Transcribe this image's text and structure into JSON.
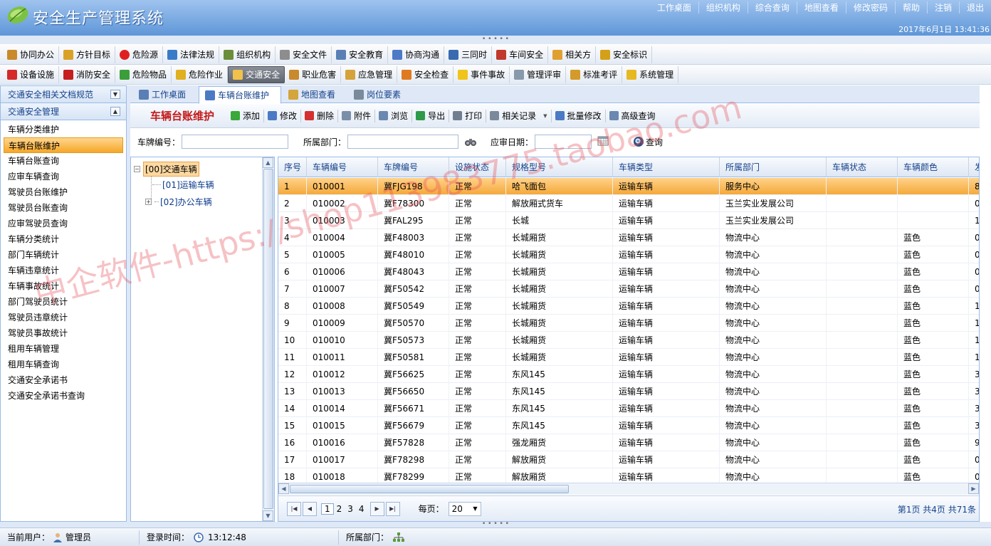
{
  "app": {
    "title": "安全生产管理系统",
    "datetime": "2017年6月1日 13:41:36"
  },
  "top_links": [
    "工作桌面",
    "组织机构",
    "综合查询",
    "地图查看",
    "修改密码",
    "帮助",
    "注销",
    "退出"
  ],
  "menu_row1": [
    {
      "label": "协同办公",
      "icon": "people-icon",
      "color": "#c98a2b"
    },
    {
      "label": "方针目标",
      "icon": "clock-icon",
      "color": "#d9a227"
    },
    {
      "label": "危险源",
      "icon": "red-dot-icon",
      "color": "#e02020"
    },
    {
      "label": "法律法规",
      "icon": "book-icon",
      "color": "#3a7bc8"
    },
    {
      "label": "组织机构",
      "icon": "org-chart-icon",
      "color": "#6b8e3a"
    },
    {
      "label": "安全文件",
      "icon": "document-icon",
      "color": "#8d8d8d"
    },
    {
      "label": "安全教育",
      "icon": "speech-icon",
      "color": "#5a7fb5"
    },
    {
      "label": "协商沟通",
      "icon": "mail-icon",
      "color": "#4c7ac6"
    },
    {
      "label": "三同时",
      "icon": "list-icon",
      "color": "#3a6ab0"
    },
    {
      "label": "车间安全",
      "icon": "worker-icon",
      "color": "#c0392b"
    },
    {
      "label": "相关方",
      "icon": "handshake-icon",
      "color": "#e0a030"
    },
    {
      "label": "安全标识",
      "icon": "flag-icon",
      "color": "#d4a017"
    }
  ],
  "menu_row2": [
    {
      "label": "设备设施",
      "icon": "device-icon",
      "color": "#d42a2a"
    },
    {
      "label": "消防安全",
      "icon": "fire-extinguisher-icon",
      "color": "#c41e1e"
    },
    {
      "label": "危险物品",
      "icon": "flask-icon",
      "color": "#3b9e3b"
    },
    {
      "label": "危险作业",
      "icon": "hazard-icon",
      "color": "#e0b020"
    },
    {
      "label": "交通安全",
      "icon": "truck-icon",
      "color": "#f1c14b",
      "active": true
    },
    {
      "label": "职业危害",
      "icon": "people-icon",
      "color": "#c98a2b"
    },
    {
      "label": "应急管理",
      "icon": "emergency-icon",
      "color": "#d6a33a"
    },
    {
      "label": "安全检查",
      "icon": "magnifier-icon",
      "color": "#e07a20"
    },
    {
      "label": "事件事故",
      "icon": "warning-icon",
      "color": "#f0c419"
    },
    {
      "label": "管理评审",
      "icon": "review-icon",
      "color": "#8899aa"
    },
    {
      "label": "标准考评",
      "icon": "pencil-icon",
      "color": "#d49a2a"
    },
    {
      "label": "系统管理",
      "icon": "lock-icon",
      "color": "#e8b820"
    }
  ],
  "sidebar": {
    "section1": "交通安全相关文档规范",
    "section2": "交通安全管理",
    "items": [
      "车辆分类维护",
      "车辆台账维护",
      "车辆台账查询",
      "应审车辆查询",
      "驾驶员台账维护",
      "驾驶员台账查询",
      "应审驾驶员查询",
      "车辆分类统计",
      "部门车辆统计",
      "车辆违章统计",
      "车辆事故统计",
      "部门驾驶员统计",
      "驾驶员违章统计",
      "驾驶员事故统计",
      "租用车辆管理",
      "租用车辆查询",
      "交通安全承诺书",
      "交通安全承诺书查询"
    ],
    "selected_index": 1
  },
  "tabs": [
    {
      "label": "工作桌面",
      "icon": "desktop-icon"
    },
    {
      "label": "车辆台账维护",
      "icon": "edit-icon",
      "active": true
    },
    {
      "label": "地图查看",
      "icon": "map-icon"
    },
    {
      "label": "岗位要素",
      "icon": "list-icon"
    }
  ],
  "toolbar": {
    "title": "车辆台账维护",
    "buttons": [
      {
        "label": "添加",
        "icon": "add-icon",
        "color": "#3aa83a"
      },
      {
        "label": "修改",
        "icon": "edit-icon",
        "color": "#4b7ac4"
      },
      {
        "label": "删除",
        "icon": "delete-icon",
        "color": "#d43030"
      },
      {
        "label": "附件",
        "icon": "attachment-icon",
        "color": "#7a8fa8"
      },
      {
        "label": "浏览",
        "icon": "browse-icon",
        "color": "#6a88b0"
      },
      {
        "label": "导出",
        "icon": "export-icon",
        "color": "#2f9a4a"
      },
      {
        "label": "打印",
        "icon": "printer-icon",
        "color": "#6f7f90"
      },
      {
        "label": "相关记录",
        "icon": "truck-icon",
        "color": "#7a8a9a",
        "dropdown": true
      },
      {
        "label": "批量修改",
        "icon": "batch-edit-icon",
        "color": "#4b7ac4"
      },
      {
        "label": "高级查询",
        "icon": "advanced-search-icon",
        "color": "#6a88b0"
      }
    ]
  },
  "search": {
    "plate_label": "车牌编号：",
    "plate_value": "",
    "dept_label": "所属部门：",
    "dept_value": "",
    "date_label": "应审日期：",
    "date_value": "",
    "query_label": "查询"
  },
  "tree": {
    "root": "[00]交通车辆",
    "children": [
      "[01]运输车辆",
      "[02]办公车辆"
    ]
  },
  "grid": {
    "columns": [
      "序号",
      "车辆编号",
      "车牌编号",
      "设施状态",
      "规格型号",
      "车辆类型",
      "所属部门",
      "车辆状态",
      "车辆颜色",
      "发"
    ],
    "rows": [
      [
        "1",
        "010001",
        "冀FJG198",
        "正常",
        "哈飞面包",
        "运输车辆",
        "服务中心",
        "",
        "",
        "8"
      ],
      [
        "2",
        "010002",
        "冀F78300",
        "正常",
        "解放厢式货车",
        "运输车辆",
        "玉兰实业发展公司",
        "",
        "",
        "0"
      ],
      [
        "3",
        "010003",
        "冀FAL295",
        "正常",
        "长城",
        "运输车辆",
        "玉兰实业发展公司",
        "",
        "",
        "1"
      ],
      [
        "4",
        "010004",
        "冀F48003",
        "正常",
        "长城厢货",
        "运输车辆",
        "物流中心",
        "",
        "蓝色",
        "0"
      ],
      [
        "5",
        "010005",
        "冀F48010",
        "正常",
        "长城厢货",
        "运输车辆",
        "物流中心",
        "",
        "蓝色",
        "0"
      ],
      [
        "6",
        "010006",
        "冀F48043",
        "正常",
        "长城厢货",
        "运输车辆",
        "物流中心",
        "",
        "蓝色",
        "0"
      ],
      [
        "7",
        "010007",
        "冀F50542",
        "正常",
        "长城厢货",
        "运输车辆",
        "物流中心",
        "",
        "蓝色",
        "0"
      ],
      [
        "8",
        "010008",
        "冀F50549",
        "正常",
        "长城厢货",
        "运输车辆",
        "物流中心",
        "",
        "蓝色",
        "1"
      ],
      [
        "9",
        "010009",
        "冀F50570",
        "正常",
        "长城厢货",
        "运输车辆",
        "物流中心",
        "",
        "蓝色",
        "1"
      ],
      [
        "10",
        "010010",
        "冀F50573",
        "正常",
        "长城厢货",
        "运输车辆",
        "物流中心",
        "",
        "蓝色",
        "1"
      ],
      [
        "11",
        "010011",
        "冀F50581",
        "正常",
        "长城厢货",
        "运输车辆",
        "物流中心",
        "",
        "蓝色",
        "1"
      ],
      [
        "12",
        "010012",
        "冀F56625",
        "正常",
        "东风145",
        "运输车辆",
        "物流中心",
        "",
        "蓝色",
        "3"
      ],
      [
        "13",
        "010013",
        "冀F56650",
        "正常",
        "东风145",
        "运输车辆",
        "物流中心",
        "",
        "蓝色",
        "3"
      ],
      [
        "14",
        "010014",
        "冀F56671",
        "正常",
        "东风145",
        "运输车辆",
        "物流中心",
        "",
        "蓝色",
        "3"
      ],
      [
        "15",
        "010015",
        "冀F56679",
        "正常",
        "东风145",
        "运输车辆",
        "物流中心",
        "",
        "蓝色",
        "3"
      ],
      [
        "16",
        "010016",
        "冀F57828",
        "正常",
        "强龙厢货",
        "运输车辆",
        "物流中心",
        "",
        "蓝色",
        "9"
      ],
      [
        "17",
        "010017",
        "冀F78298",
        "正常",
        "解放厢货",
        "运输车辆",
        "物流中心",
        "",
        "蓝色",
        "0"
      ],
      [
        "18",
        "010018",
        "冀F78299",
        "正常",
        "解放厢货",
        "运输车辆",
        "物流中心",
        "",
        "蓝色",
        "0"
      ]
    ],
    "selected_row": 0
  },
  "pager": {
    "pages": [
      "1",
      "2",
      "3",
      "4"
    ],
    "current": "1",
    "per_page_label": "每页：",
    "per_page_value": "20",
    "info": "第1页  共4页  共71条"
  },
  "status": {
    "user_label": "当前用户：",
    "user": "管理员",
    "login_label": "登录时间：",
    "login_time": "13:12:48",
    "dept_label": "所属部门："
  },
  "watermark": "中企软件-https://shop113983775.taobao.com"
}
